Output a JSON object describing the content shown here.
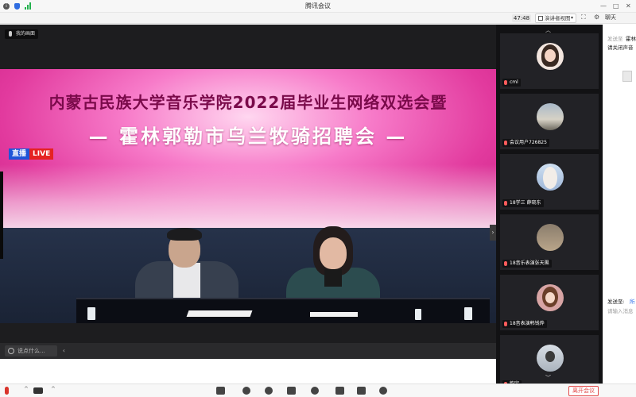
{
  "window": {
    "title": "腾讯会议"
  },
  "toolbar": {
    "timer": "47:48",
    "view_label": "演讲者视图",
    "chat_tab": "聊天"
  },
  "video": {
    "screen_share_label": "我的画面",
    "banner_line1": "内蒙古民族大学音乐学院2022届毕业生网络双选会暨",
    "banner_line2": "— 霍林郭勒市乌兰牧骑招聘会 —",
    "live_zh": "直播",
    "live_en": "LIVE"
  },
  "input": {
    "placeholder": "说点什么..."
  },
  "participants": [
    {
      "name": "cml"
    },
    {
      "name": "会议用户726825"
    },
    {
      "name": "18学三 薛晓东"
    },
    {
      "name": "18音乐表演张天隰"
    },
    {
      "name": "18音表演韩钱烨"
    },
    {
      "name": "韵宇"
    }
  ],
  "chat": {
    "line1_prefix": "发送至",
    "line1_value": "霍林",
    "line2": "请关闭声音",
    "send_to_label": "发送至:",
    "send_to_value": "所",
    "input_placeholder": "请输入消息"
  },
  "bottombar": {
    "leave_label": "离开会议"
  }
}
